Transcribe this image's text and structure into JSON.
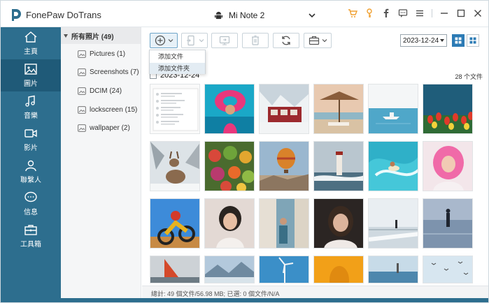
{
  "app": {
    "title": "FonePaw DoTrans"
  },
  "device": {
    "name": "Mi Note 2"
  },
  "titlebar_icons": [
    "cart-icon",
    "key-icon",
    "facebook-icon",
    "chat-icon",
    "menu-icon",
    "minimize-icon",
    "maximize-icon",
    "close-icon"
  ],
  "sidebar": {
    "items": [
      {
        "label": "主頁",
        "icon": "home-icon"
      },
      {
        "label": "圖片",
        "icon": "picture-icon"
      },
      {
        "label": "音樂",
        "icon": "music-icon"
      },
      {
        "label": "影片",
        "icon": "video-icon"
      },
      {
        "label": "聯繫人",
        "icon": "contacts-icon"
      },
      {
        "label": "信息",
        "icon": "message-icon"
      },
      {
        "label": "工具箱",
        "icon": "toolbox-icon"
      }
    ]
  },
  "albums": {
    "header": "所有照片 (49)",
    "items": [
      {
        "label": "Pictures (1)"
      },
      {
        "label": "Screenshots (7)"
      },
      {
        "label": "DCIM (24)"
      },
      {
        "label": "lockscreen (15)"
      },
      {
        "label": "wallpaper (2)"
      }
    ]
  },
  "toolbar": {
    "buttons": [
      "add-icon",
      "export-to-device-icon",
      "export-to-pc-icon",
      "delete-icon",
      "refresh-icon",
      "toolbox-icon"
    ],
    "date_value": "2023-12-24"
  },
  "add_menu": {
    "items": [
      {
        "label": "添加文件"
      },
      {
        "label": "添加文件夾"
      }
    ]
  },
  "group": {
    "date": "2023-12-24",
    "count": "28 个文件"
  },
  "status": {
    "text": "總計: 49 個文件/56.98 MB; 已選: 0 個文件/N/A"
  },
  "colors": {
    "sidebar": "#2d6e8e",
    "sidebar_active": "#1f5a78",
    "accent": "#2c7bb5"
  }
}
